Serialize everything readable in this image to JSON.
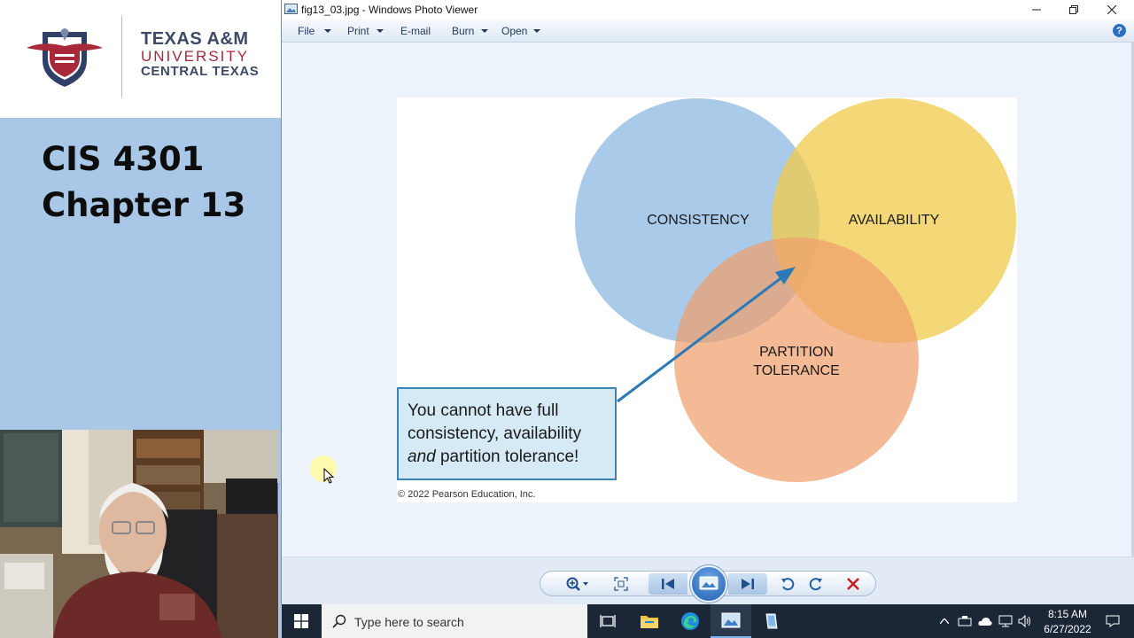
{
  "slide": {
    "logo": {
      "line1": "TEXAS A&M",
      "line2": "UNIVERSITY",
      "line3": "CENTRAL TEXAS"
    },
    "course_code": "CIS 4301",
    "chapter": "Chapter 13"
  },
  "window": {
    "title": "fig13_03.jpg - Windows Photo Viewer",
    "menu": [
      {
        "label": "File"
      },
      {
        "label": "Print"
      },
      {
        "label": "E-mail"
      },
      {
        "label": "Burn"
      },
      {
        "label": "Open"
      }
    ],
    "help": "?"
  },
  "figure": {
    "labels": {
      "consistency": "CONSISTENCY",
      "availability": "AVAILABILITY",
      "partition_line1": "PARTITION",
      "partition_line2": "TOLERANCE"
    },
    "note": {
      "part1": "You cannot have full consistency, availability ",
      "emphasis": "and",
      "part2": " partition tolerance!"
    },
    "copyright": "© 2022 Pearson Education, Inc.",
    "colors": {
      "consistency": "#8db8e2",
      "availability": "#f1cc50",
      "partition": "#eea06c",
      "arrow": "#2a7ab8"
    }
  },
  "taskbar": {
    "search_placeholder": "Type here to search",
    "time": "8:15 AM",
    "date": "6/27/2022"
  }
}
